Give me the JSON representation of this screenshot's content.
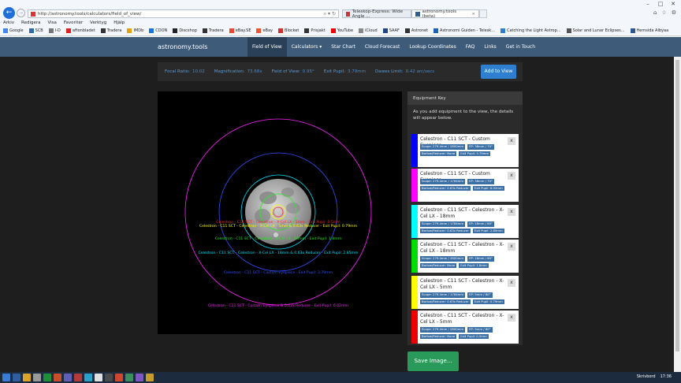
{
  "browser": {
    "url": "http://astronomy.tools/calculators/field_of_view/",
    "tabs": [
      {
        "label": "Teleskop-Express: Wide Angle ..."
      },
      {
        "label": "astronomy.tools (beta)"
      }
    ],
    "menu": [
      "Arkiv",
      "Redigera",
      "Visa",
      "Favoriter",
      "Verktyg",
      "Hjälp"
    ],
    "favorites": [
      "Google",
      "SCB",
      "I-D",
      "aftonbladet",
      "Tradera",
      "IMDb",
      "CDON",
      "Discshop",
      "Tradera",
      "eBay.SE",
      "eBay",
      "Blocket",
      "Prisjakt",
      "YouTube",
      "iCloud",
      "SAAF",
      "Astronet",
      "Astronomi Guiden - Telesk...",
      "Catching the Light Astrop...",
      "Solar and Lunar Eclipses...",
      "Hemsida Albyaa"
    ],
    "win": {
      "min": "–",
      "max": "□",
      "close": "✕"
    }
  },
  "site": {
    "brand": "astronomy.tools",
    "nav": [
      "Field of View",
      "Calculators ▾",
      "Star Chart",
      "Cloud Forecast",
      "Lookup Coordinates",
      "FAQ",
      "Links",
      "Get in Touch"
    ]
  },
  "settings": {
    "stats": [
      {
        "label": "Focal Ratio:",
        "value": "10.02"
      },
      {
        "label": "Magnification:",
        "value": "73.68x"
      },
      {
        "label": "Field of View:",
        "value": "0.95°"
      },
      {
        "label": "Exit Pupil:",
        "value": "3.79mm"
      },
      {
        "label": "Dawes Limit:",
        "value": "0.42 arc/secs"
      }
    ],
    "add_button": "Add to View"
  },
  "fov": {
    "labels": [
      {
        "text": "Celestron - C11 SCT - Celestron - X-Cel LX - 5mm - Exit Pupil: 0.5mm",
        "color": "#ff2020"
      },
      {
        "text": "Celestron - C11 SCT - Celestron - X-Cel LX - 5mm & 0.63x Reducer - Exit Pupil: 0.79mm",
        "color": "#ffff00"
      },
      {
        "text": "Celestron - C11 SCT - Celestron - X-Cel LX - 18mm - Exit Pupil: 1.8mm",
        "color": "#22ee22"
      },
      {
        "text": "Celestron - C11 SCT - Celestron - X-Cel LX - 18mm & 0.63x Reducer - Exit Pupil: 2.85mm",
        "color": "#00e5ff"
      },
      {
        "text": "Celestron - C11 SCT - Custom Eyepiece - Exit Pupil: 3.79mm",
        "color": "#3050ff"
      },
      {
        "text": "Celestron - C11 SCT - Custom Eyepiece & 0.63x Reducer - Exit Pupil: 6.02mm",
        "color": "#ff22ff"
      }
    ]
  },
  "key": {
    "header": "Equipment Key",
    "intro": "As you add equipment to the view, the details will appear below.",
    "close": "x",
    "cards": [
      {
        "title": "Celestron - C11 SCT - Custom Eyepiece",
        "color": "#0000ff",
        "badges": [
          "Scope: 279.4mm / 2800mm",
          "EP: 38mm / 70°",
          "Barlow/Reducer: None",
          "Exit Pupil: 3.79mm"
        ]
      },
      {
        "title": "Celestron - C11 SCT - Custom Eyepiece",
        "color": "#ff00ff",
        "badges": [
          "Scope: 279.4mm / 1764mm",
          "EP: 38mm / 70°",
          "Barlow/Reducer: 0.63x Reducer",
          "Exit Pupil: 6.02mm"
        ]
      },
      {
        "title": "Celestron - C11 SCT - Celestron - X-Cel LX - 18mm",
        "color": "#00ffff",
        "badges": [
          "Scope: 279.4mm / 1764mm",
          "EP: 18mm / 60°",
          "Barlow/Reducer: 0.63x Reducer",
          "Exit Pupil: 2.85mm"
        ]
      },
      {
        "title": "Celestron - C11 SCT - Celestron - X-Cel LX - 18mm",
        "color": "#00dd00",
        "badges": [
          "Scope: 279.4mm / 2800mm",
          "EP: 18mm / 60°",
          "Barlow/Reducer: None",
          "Exit Pupil: 1.8mm"
        ]
      },
      {
        "title": "Celestron - C11 SCT - Celestron - X-Cel LX - 5mm",
        "color": "#ffff00",
        "badges": [
          "Scope: 279.4mm / 1764mm",
          "EP: 5mm / 60°",
          "Barlow/Reducer: 0.63x Reducer",
          "Exit Pupil: 0.79mm"
        ]
      },
      {
        "title": "Celestron - C11 SCT - Celestron - X-Cel LX - 5mm",
        "color": "#ee0000",
        "badges": [
          "Scope: 279.4mm / 2800mm",
          "EP: 5mm / 60°",
          "Barlow/Reducer: None",
          "Exit Pupil: 0.5mm"
        ]
      }
    ]
  },
  "save_button": "Save Image...",
  "taskbar": {
    "lang": "Skrivbord",
    "time": "17:36"
  }
}
